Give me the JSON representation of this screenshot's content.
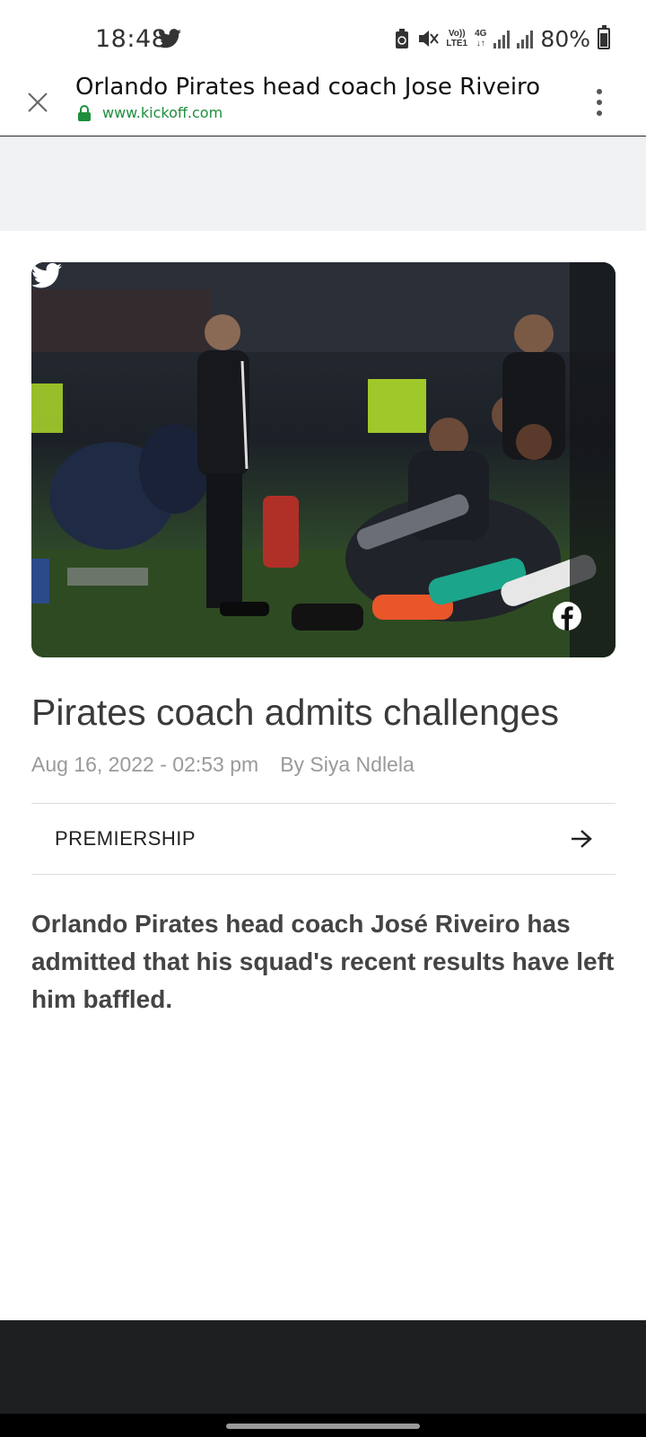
{
  "status_bar": {
    "time": "18:48",
    "network_top": "Vo))",
    "network_bottom": "LTE1",
    "data_type": "4G",
    "battery": "80%"
  },
  "browser": {
    "page_title": "Orlando Pirates head coach Jose Riveiro",
    "url": "www.kickoff.com",
    "accent_color": "#1e8e3e"
  },
  "article": {
    "headline": "Pirates coach admits challenges",
    "date": "Aug 16, 2022 - 02:53 pm",
    "author": "By Siya Ndlela",
    "category": "PREMIERSHIP",
    "intro": "Orlando Pirates head coach José Riveiro has admitted that his squad's recent results have left him baffled."
  },
  "icons": {
    "close": "close-icon",
    "menu": "more-vert-icon",
    "lock": "lock-icon",
    "share_twitter": "twitter-icon",
    "share_facebook": "facebook-icon",
    "category_arrow": "arrow-right-icon"
  }
}
